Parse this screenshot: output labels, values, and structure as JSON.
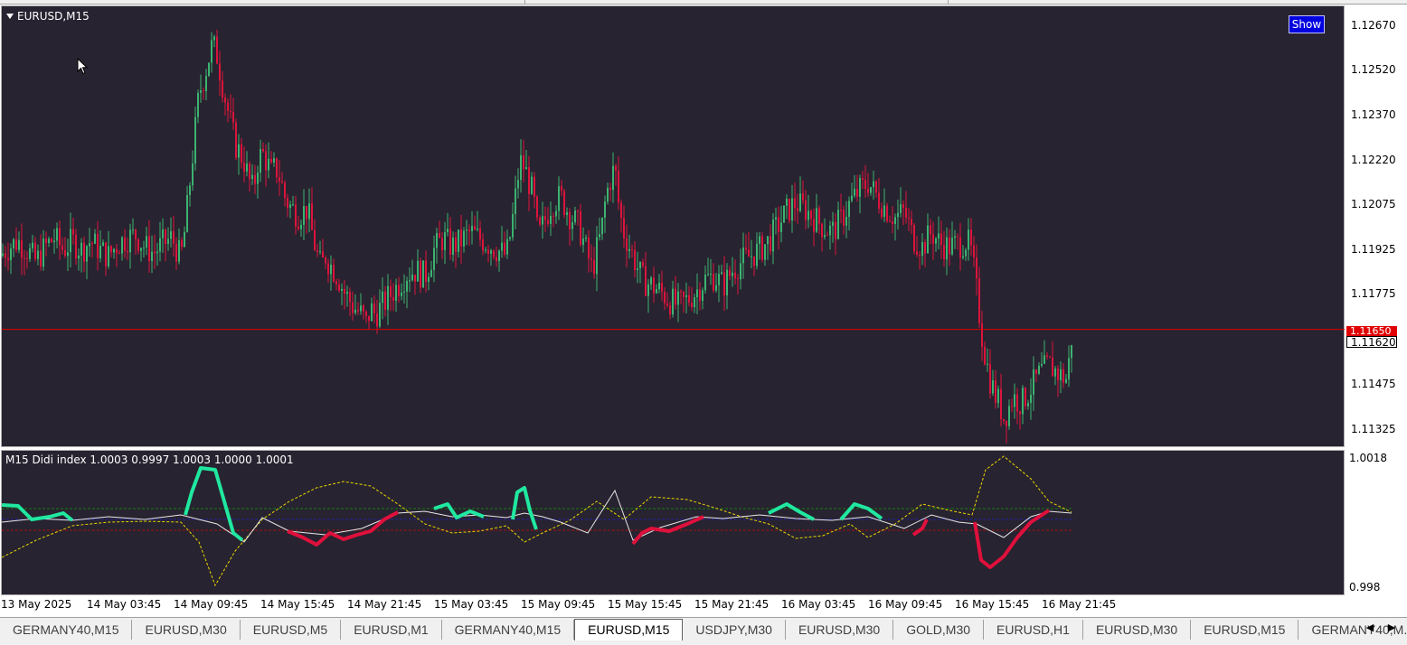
{
  "window": {
    "symbol_title": "EURUSD,M15",
    "show_button_label": "Show",
    "indicator_title": "M15 Didi index 1.0003 0.9997 1.0003 1.0000 1.0001"
  },
  "price_axis": {
    "labels": [
      "1.12670",
      "1.12520",
      "1.12370",
      "1.12220",
      "1.12075",
      "1.11925",
      "1.11775",
      "1.11620",
      "1.11475",
      "1.11325"
    ],
    "bid_label": "1.11650",
    "current_label": "1.11620"
  },
  "indicator_axis": {
    "labels": [
      "1.0018",
      "0.998"
    ]
  },
  "time_axis": {
    "labels": [
      "13 May 2025",
      "14 May 03:45",
      "14 May 09:45",
      "14 May 15:45",
      "14 May 21:45",
      "15 May 03:45",
      "15 May 09:45",
      "15 May 15:45",
      "15 May 21:45",
      "16 May 03:45",
      "16 May 09:45",
      "16 May 15:45",
      "16 May 21:45"
    ]
  },
  "tabs": [
    {
      "label": "GERMANY40,M15",
      "active": false
    },
    {
      "label": "EURUSD,M30",
      "active": false
    },
    {
      "label": "EURUSD,M5",
      "active": false
    },
    {
      "label": "EURUSD,M1",
      "active": false
    },
    {
      "label": "GERMANY40,M15",
      "active": false
    },
    {
      "label": "EURUSD,M15",
      "active": true
    },
    {
      "label": "USDJPY,M30",
      "active": false
    },
    {
      "label": "EURUSD,M30",
      "active": false
    },
    {
      "label": "GOLD,M30",
      "active": false
    },
    {
      "label": "EURUSD,H1",
      "active": false
    },
    {
      "label": "EURUSD,M30",
      "active": false
    },
    {
      "label": "EURUSD,M15",
      "active": false
    },
    {
      "label": "GERMANY40,M...",
      "active": false
    }
  ],
  "tab_scroll": {
    "left_icon": "◀",
    "right_icon": "▶"
  },
  "colors": {
    "background": "#282330",
    "bull_candle": "#3cb371",
    "bear_candle": "#dc143c",
    "bid_line": "#e00000",
    "didi_up": "#20e8a0",
    "didi_down": "#e0103c",
    "didi_white": "#e8e8e8",
    "didi_yellow": "#e8d800",
    "level_green": "#108010",
    "level_blue": "#2020a0",
    "level_red": "#a01010"
  },
  "chart_data": {
    "type": "candlestick",
    "symbol": "EURUSD",
    "timeframe": "M15",
    "ylim": [
      1.1125,
      1.1275
    ],
    "bid": 1.1165,
    "close_points": [
      [
        0,
        1.119
      ],
      [
        10,
        1.1193
      ],
      [
        20,
        1.1195
      ],
      [
        30,
        1.1192
      ],
      [
        40,
        1.1188
      ],
      [
        50,
        1.1193
      ],
      [
        60,
        1.1196
      ],
      [
        70,
        1.1192
      ],
      [
        80,
        1.1195
      ],
      [
        90,
        1.1192
      ],
      [
        100,
        1.1195
      ],
      [
        110,
        1.1192
      ],
      [
        120,
        1.119
      ],
      [
        130,
        1.1194
      ],
      [
        140,
        1.1196
      ],
      [
        150,
        1.1197
      ],
      [
        160,
        1.1193
      ],
      [
        170,
        1.1191
      ],
      [
        180,
        1.1194
      ],
      [
        190,
        1.1196
      ],
      [
        200,
        1.1189
      ],
      [
        205,
        1.12
      ],
      [
        210,
        1.1215
      ],
      [
        215,
        1.123
      ],
      [
        220,
        1.1245
      ],
      [
        225,
        1.125
      ],
      [
        230,
        1.1256
      ],
      [
        235,
        1.1262
      ],
      [
        240,
        1.1258
      ],
      [
        245,
        1.125
      ],
      [
        250,
        1.1242
      ],
      [
        255,
        1.1235
      ],
      [
        260,
        1.1228
      ],
      [
        265,
        1.1225
      ],
      [
        270,
        1.1222
      ],
      [
        275,
        1.1216
      ],
      [
        280,
        1.1212
      ],
      [
        285,
        1.1222
      ],
      [
        290,
        1.1225
      ],
      [
        295,
        1.1222
      ],
      [
        300,
        1.1218
      ],
      [
        305,
        1.122
      ],
      [
        310,
        1.1216
      ],
      [
        315,
        1.121
      ],
      [
        320,
        1.1207
      ],
      [
        330,
        1.1204
      ],
      [
        340,
        1.1206
      ],
      [
        345,
        1.1198
      ],
      [
        350,
        1.1191
      ],
      [
        355,
        1.1186
      ],
      [
        360,
        1.119
      ],
      [
        365,
        1.1187
      ],
      [
        370,
        1.1185
      ],
      [
        375,
        1.1182
      ],
      [
        380,
        1.1178
      ],
      [
        390,
        1.1173
      ],
      [
        400,
        1.117
      ],
      [
        405,
        1.1167
      ],
      [
        410,
        1.1172
      ],
      [
        415,
        1.117
      ],
      [
        420,
        1.1172
      ],
      [
        430,
        1.1176
      ],
      [
        440,
        1.118
      ],
      [
        450,
        1.1184
      ],
      [
        460,
        1.1185
      ],
      [
        470,
        1.1183
      ],
      [
        480,
        1.1192
      ],
      [
        490,
        1.1196
      ],
      [
        500,
        1.1193
      ],
      [
        510,
        1.1195
      ],
      [
        520,
        1.1198
      ],
      [
        530,
        1.1196
      ],
      [
        540,
        1.1194
      ],
      [
        550,
        1.1192
      ],
      [
        560,
        1.119
      ],
      [
        565,
        1.1198
      ],
      [
        570,
        1.121
      ],
      [
        575,
        1.1222
      ],
      [
        580,
        1.122
      ],
      [
        585,
        1.1215
      ],
      [
        590,
        1.121
      ],
      [
        595,
        1.1196
      ],
      [
        600,
        1.12
      ],
      [
        610,
        1.1208
      ],
      [
        620,
        1.121
      ],
      [
        630,
        1.1204
      ],
      [
        640,
        1.12
      ],
      [
        650,
        1.119
      ],
      [
        655,
        1.1185
      ],
      [
        660,
        1.1192
      ],
      [
        665,
        1.1198
      ],
      [
        670,
        1.121
      ],
      [
        675,
        1.1216
      ],
      [
        680,
        1.122
      ],
      [
        685,
        1.1205
      ],
      [
        690,
        1.1198
      ],
      [
        700,
        1.119
      ],
      [
        710,
        1.1182
      ],
      [
        720,
        1.118
      ],
      [
        730,
        1.1178
      ],
      [
        740,
        1.1175
      ],
      [
        750,
        1.1173
      ],
      [
        760,
        1.1175
      ],
      [
        770,
        1.1178
      ],
      [
        780,
        1.1182
      ],
      [
        790,
        1.1183
      ],
      [
        800,
        1.118
      ],
      [
        810,
        1.1185
      ],
      [
        820,
        1.1188
      ],
      [
        830,
        1.119
      ],
      [
        840,
        1.1192
      ],
      [
        850,
        1.1195
      ],
      [
        860,
        1.12
      ],
      [
        870,
        1.1205
      ],
      [
        880,
        1.1208
      ],
      [
        890,
        1.1206
      ],
      [
        900,
        1.1203
      ],
      [
        910,
        1.12
      ],
      [
        920,
        1.1198
      ],
      [
        930,
        1.1202
      ],
      [
        940,
        1.1208
      ],
      [
        950,
        1.1212
      ],
      [
        960,
        1.1215
      ],
      [
        970,
        1.121
      ],
      [
        980,
        1.1206
      ],
      [
        990,
        1.1203
      ],
      [
        1000,
        1.1205
      ],
      [
        1010,
        1.1196
      ],
      [
        1020,
        1.1193
      ],
      [
        1030,
        1.1198
      ],
      [
        1040,
        1.1194
      ],
      [
        1050,
        1.1193
      ],
      [
        1060,
        1.1194
      ],
      [
        1070,
        1.1195
      ],
      [
        1075,
        1.119
      ],
      [
        1080,
        1.1178
      ],
      [
        1085,
        1.1165
      ],
      [
        1090,
        1.1155
      ],
      [
        1095,
        1.1148
      ],
      [
        1100,
        1.1143
      ],
      [
        1105,
        1.114
      ],
      [
        1110,
        1.1135
      ],
      [
        1115,
        1.1138
      ],
      [
        1120,
        1.1142
      ],
      [
        1130,
        1.114
      ],
      [
        1140,
        1.1145
      ],
      [
        1150,
        1.115
      ],
      [
        1160,
        1.1153
      ],
      [
        1170,
        1.115
      ],
      [
        1180,
        1.1148
      ],
      [
        1185,
        1.1162
      ]
    ]
  }
}
